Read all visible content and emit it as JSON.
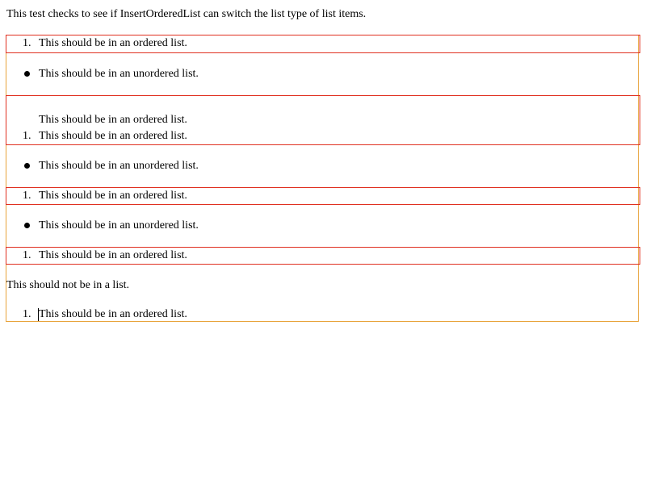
{
  "intro_text": "This test checks to see if InsertOrderedList can switch the list type of list items.",
  "items": {
    "ordered_1": {
      "marker": "1.",
      "text": "This should be in an ordered list."
    },
    "unordered_1": {
      "text": "This should be in an unordered list."
    },
    "ordered_2_line1": {
      "text": "This should be in an ordered list."
    },
    "ordered_2_line2": {
      "marker": "1.",
      "text": "This should be in an ordered list."
    },
    "unordered_2": {
      "text": "This should be in an unordered list."
    },
    "ordered_3": {
      "marker": "1.",
      "text": "This should be in an ordered list."
    },
    "unordered_3": {
      "text": "This should be in an unordered list."
    },
    "ordered_4": {
      "marker": "1.",
      "text": "This should be in an ordered list."
    },
    "plain": {
      "text": "This should not be in a list."
    },
    "ordered_5": {
      "marker": "1.",
      "text": "This should be in an ordered list."
    }
  },
  "colors": {
    "editable_border": "#e8a33b",
    "ordered_list_border": "#e03020"
  }
}
